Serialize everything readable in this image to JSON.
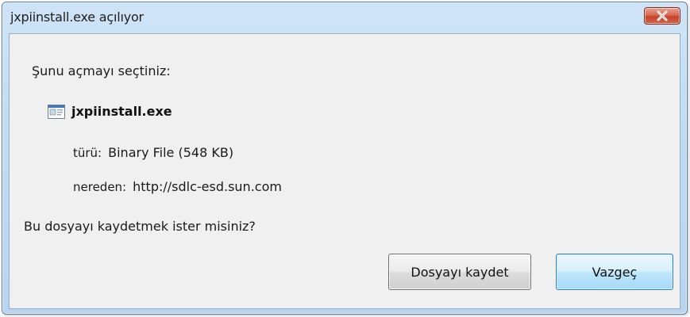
{
  "window": {
    "title": "jxpiinstall.exe açılıyor",
    "close_icon": "close-icon"
  },
  "dialog": {
    "prompt": "Şunu açmayı seçtiniz:",
    "file": {
      "icon": "executable-file-icon",
      "name": "jxpiinstall.exe"
    },
    "type_label": "türü:",
    "type_value": "Binary File (548 KB)",
    "source_label": "nereden:",
    "source_value": "http://sdlc-esd.sun.com",
    "question": "Bu dosyayı kaydetmek ister misiniz?"
  },
  "buttons": {
    "save_label": "Dosyayı kaydet",
    "cancel_label": "Vazgeç"
  },
  "colors": {
    "title_bar": "#c2dbf2",
    "close_button": "#c5422b",
    "content_bg": "#f0f0f0",
    "focused_button": "#bee6fd"
  }
}
